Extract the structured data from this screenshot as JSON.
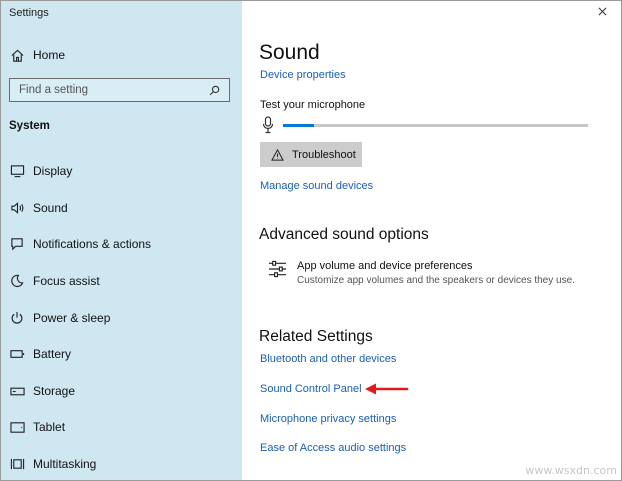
{
  "window": {
    "title": "Settings"
  },
  "sidebar": {
    "home_label": "Home",
    "search_placeholder": "Find a setting",
    "section_title": "System",
    "items": [
      {
        "label": "Display",
        "icon": "display-icon"
      },
      {
        "label": "Sound",
        "icon": "speaker-icon"
      },
      {
        "label": "Notifications & actions",
        "icon": "notifications-icon"
      },
      {
        "label": "Focus assist",
        "icon": "moon-icon"
      },
      {
        "label": "Power & sleep",
        "icon": "power-icon"
      },
      {
        "label": "Battery",
        "icon": "battery-icon"
      },
      {
        "label": "Storage",
        "icon": "storage-icon"
      },
      {
        "label": "Tablet",
        "icon": "tablet-icon"
      },
      {
        "label": "Multitasking",
        "icon": "multitasking-icon"
      }
    ]
  },
  "main": {
    "title": "Sound",
    "device_properties_link": "Device properties",
    "test_mic_label": "Test your microphone",
    "mic_level": 0.1,
    "troubleshoot_label": "Troubleshoot",
    "manage_devices_link": "Manage sound devices",
    "advanced_title": "Advanced sound options",
    "app_volume_title": "App volume and device preferences",
    "app_volume_desc": "Customize app volumes and the speakers or devices they use.",
    "related_title": "Related Settings",
    "related_links": [
      "Bluetooth and other devices",
      "Sound Control Panel",
      "Microphone privacy settings",
      "Ease of Access audio settings"
    ]
  },
  "annotation": {
    "arrow_color": "#e0191b"
  },
  "watermark": "www.wsxdn.com",
  "colors": {
    "sidebar_bg": "#cfe7f1",
    "link": "#1a5fb4",
    "accent": "#0078d4"
  }
}
